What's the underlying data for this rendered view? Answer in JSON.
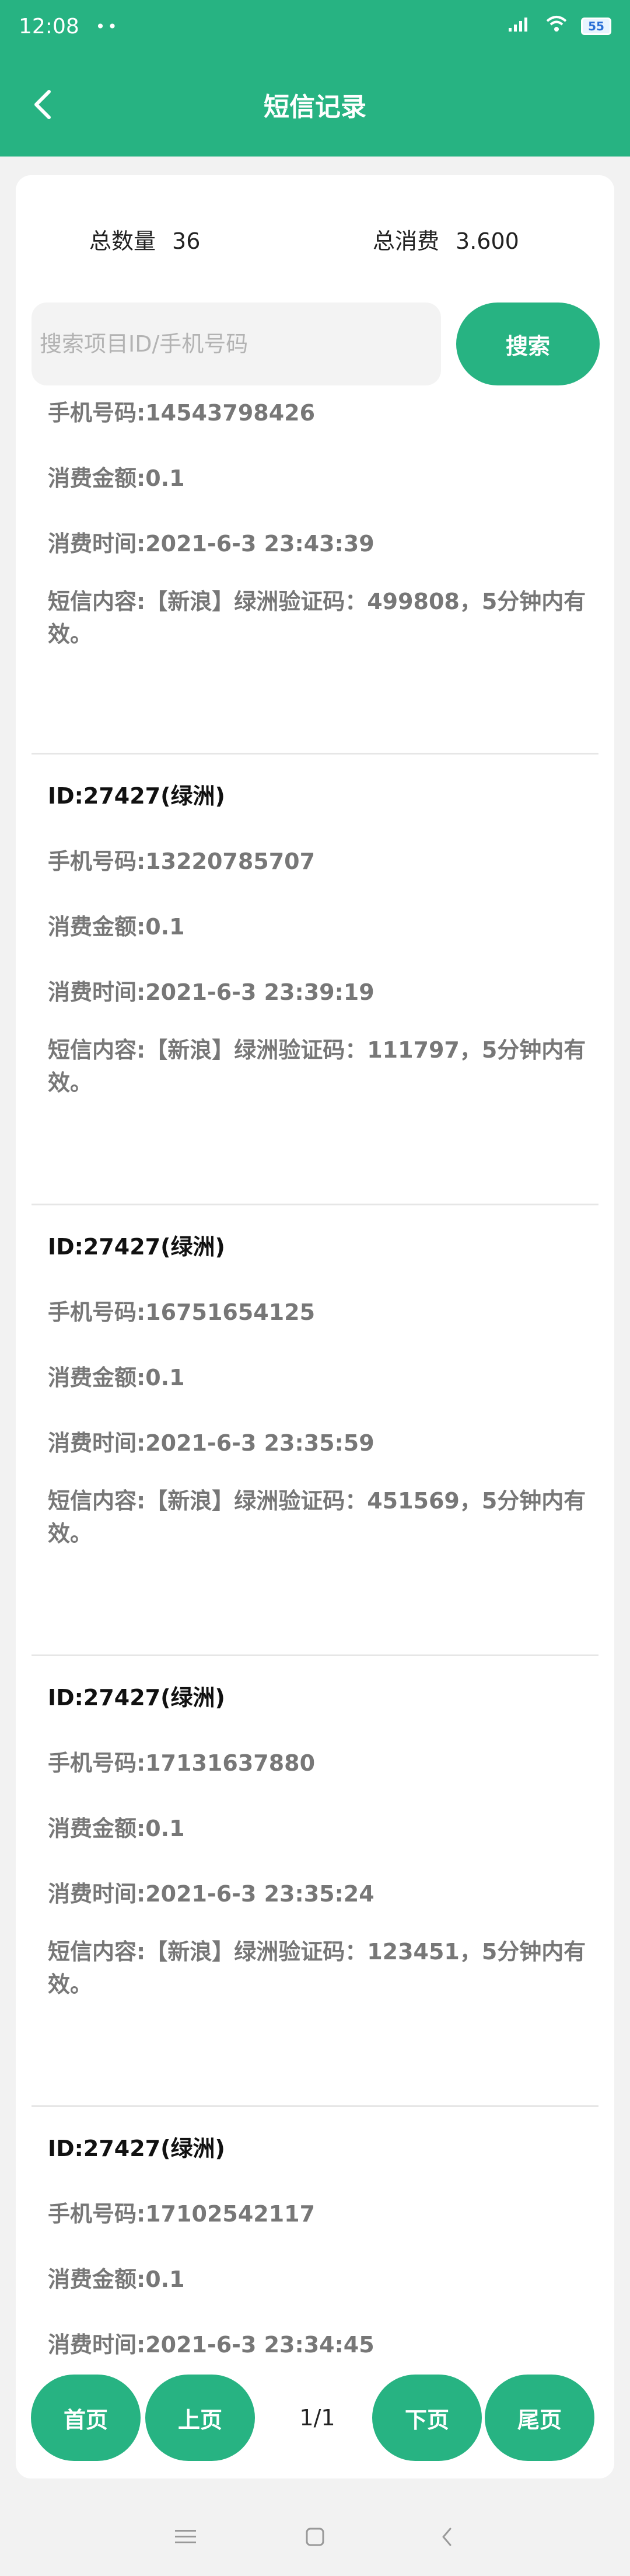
{
  "status": {
    "time": "12:08",
    "dots": "••",
    "signal": "..ıl",
    "battery": "55"
  },
  "titlebar": {
    "title": "短信记录"
  },
  "summary": {
    "count_label": "总数量",
    "count_value": "36",
    "cost_label": "总消费",
    "cost_value": "3.600"
  },
  "search": {
    "placeholder": "搜索项目ID/手机号码",
    "value": "",
    "button": "搜索"
  },
  "records": [
    {
      "id": "",
      "phone": "手机号码:14543798426",
      "amount": "消费金额:0.1",
      "time": "消费时间:2021-6-3 23:43:39",
      "content": "短信内容:【新浪】绿洲验证码：499808，5分钟内有效。"
    },
    {
      "id": "ID:27427(绿洲)",
      "phone": "手机号码:13220785707",
      "amount": "消费金额:0.1",
      "time": "消费时间:2021-6-3 23:39:19",
      "content": "短信内容:【新浪】绿洲验证码：111797，5分钟内有效。"
    },
    {
      "id": "ID:27427(绿洲)",
      "phone": "手机号码:16751654125",
      "amount": "消费金额:0.1",
      "time": "消费时间:2021-6-3 23:35:59",
      "content": "短信内容:【新浪】绿洲验证码：451569，5分钟内有效。"
    },
    {
      "id": "ID:27427(绿洲)",
      "phone": "手机号码:17131637880",
      "amount": "消费金额:0.1",
      "time": "消费时间:2021-6-3 23:35:24",
      "content": "短信内容:【新浪】绿洲验证码：123451，5分钟内有效。"
    },
    {
      "id": "ID:27427(绿洲)",
      "phone": "手机号码:17102542117",
      "amount": "消费金额:0.1",
      "time": "消费时间:2021-6-3 23:34:45",
      "content": ""
    }
  ],
  "pager": {
    "first": "首页",
    "prev": "上页",
    "indicator": "1/1",
    "next": "下页",
    "last": "尾页"
  },
  "colors": {
    "accent": "#27b382",
    "background": "#f2f2f2"
  }
}
